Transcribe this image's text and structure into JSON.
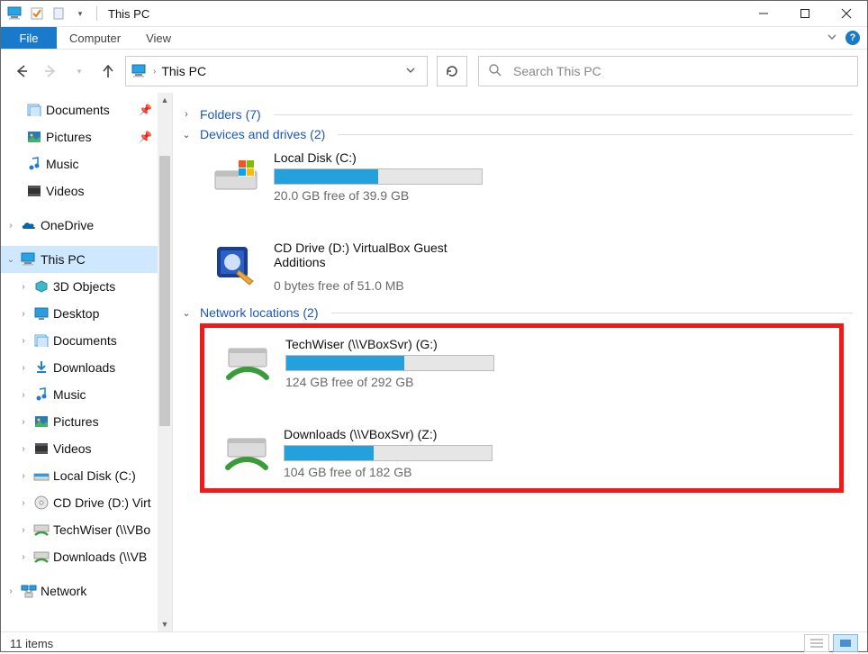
{
  "window": {
    "title": "This PC"
  },
  "ribbon": {
    "file": "File",
    "computer": "Computer",
    "view": "View"
  },
  "address": {
    "location": "This PC"
  },
  "search": {
    "placeholder": "Search This PC"
  },
  "quick_access": {
    "documents": "Documents",
    "pictures": "Pictures",
    "music": "Music",
    "videos": "Videos"
  },
  "tree": {
    "onedrive": "OneDrive",
    "thispc": "This PC",
    "children": {
      "objects3d": "3D Objects",
      "desktop": "Desktop",
      "documents": "Documents",
      "downloads": "Downloads",
      "music": "Music",
      "pictures": "Pictures",
      "videos": "Videos",
      "localdisk": "Local Disk (C:)",
      "cddrive": "CD Drive (D:) Virt",
      "techwiser": "TechWiser (\\\\VBo",
      "dlnet": "Downloads (\\\\VB"
    },
    "network": "Network"
  },
  "groups": {
    "folders": "Folders (7)",
    "devices": "Devices and drives (2)",
    "network": "Network locations (2)"
  },
  "drives": {
    "local": {
      "name": "Local Disk (C:)",
      "free": "20.0 GB free of 39.9 GB",
      "fill_pct": 50
    },
    "cd": {
      "name": "CD Drive (D:) VirtualBox Guest Additions",
      "free": "0 bytes free of 51.0 MB"
    },
    "g": {
      "name": "TechWiser (\\\\VBoxSvr) (G:)",
      "free": "124 GB free of 292 GB",
      "fill_pct": 57
    },
    "z": {
      "name": "Downloads (\\\\VBoxSvr) (Z:)",
      "free": "104 GB free of 182 GB",
      "fill_pct": 43
    }
  },
  "status": {
    "items": "11 items"
  }
}
